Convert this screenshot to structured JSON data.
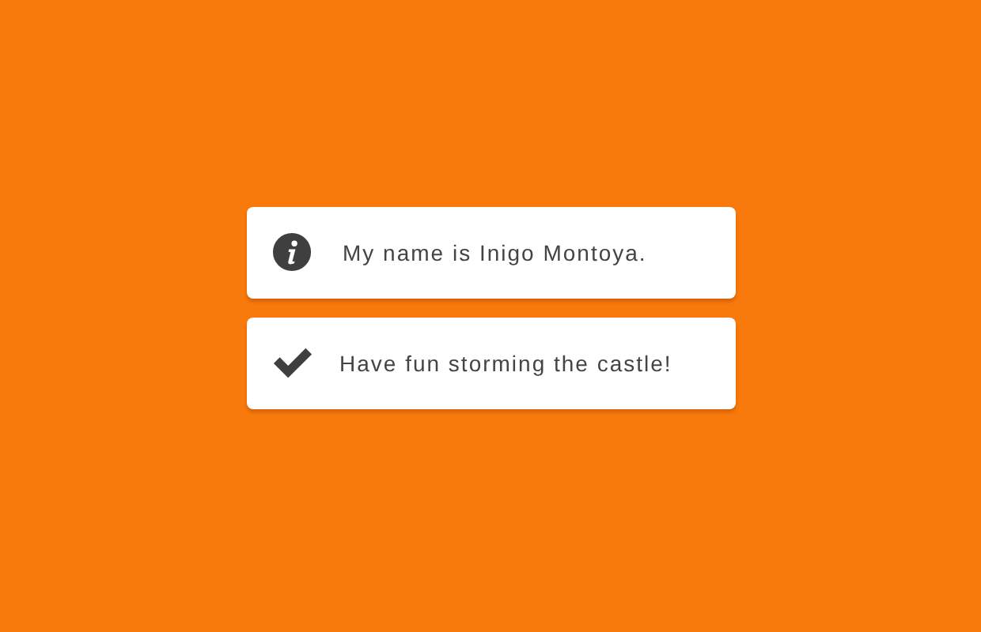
{
  "notifications": [
    {
      "kind": "info",
      "message": "My name is Inigo Montoya."
    },
    {
      "kind": "success",
      "message": "Have fun storming the castle!"
    }
  ]
}
